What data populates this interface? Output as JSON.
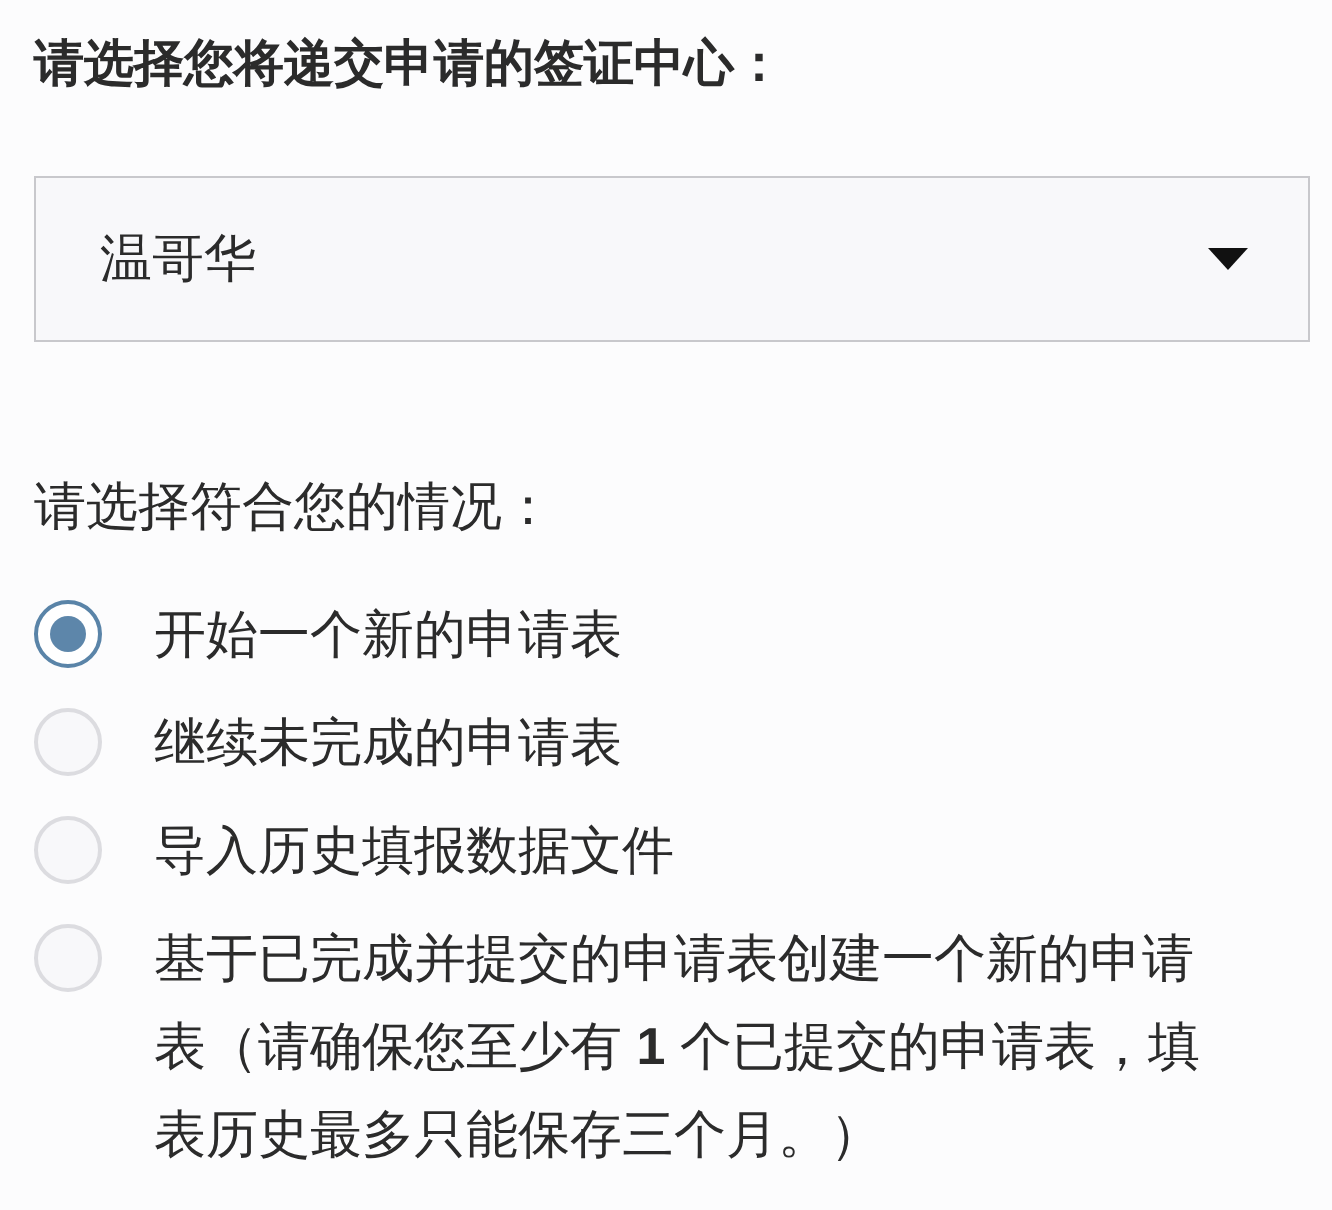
{
  "heading": "请选择您将递交申请的签证中心：",
  "visa_center_select": {
    "value": "温哥华"
  },
  "situation_prompt": "请选择符合您的情况：",
  "options": [
    {
      "label": "开始一个新的申请表",
      "selected": true
    },
    {
      "label": "继续未完成的申请表",
      "selected": false
    },
    {
      "label": "导入历史填报数据文件",
      "selected": false
    },
    {
      "label": "基于已完成并提交的申请表创建一个新的申请表（请确保您至少有 **1** 个已提交的申请表，填表历史最多只能保存三个月。）",
      "selected": false
    }
  ]
}
